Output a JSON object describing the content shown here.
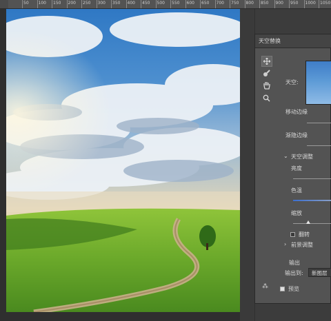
{
  "ruler": {
    "labels": [
      "50",
      "100",
      "150",
      "200",
      "250",
      "300",
      "350",
      "400",
      "450",
      "500",
      "550",
      "600",
      "650",
      "700",
      "750",
      "800",
      "850",
      "900",
      "950",
      "1000",
      "1050"
    ]
  },
  "dialog": {
    "title": "天空替换",
    "sky_label": "天空:",
    "shift_edge_label": "移动边缘",
    "fade_edge_label": "渐隐边缘",
    "sky_adjust_label": "天空调整",
    "brightness_label": "亮度",
    "temperature_label": "色温",
    "scale_label": "缩放",
    "flip_label": "翻转",
    "flip_checked": false,
    "foreground_label": "前景调整",
    "output_label": "输出",
    "output_to_label": "输出到:",
    "output_to_value": "新图层",
    "preview_label": "预览",
    "preview_checked": true
  },
  "tools": [
    "move-icon",
    "sky-brush-icon",
    "hand-icon",
    "zoom-icon"
  ],
  "colors": {
    "panel": "#535353",
    "titlebar": "#444444",
    "canvas_bg": "#2f2f2f"
  }
}
